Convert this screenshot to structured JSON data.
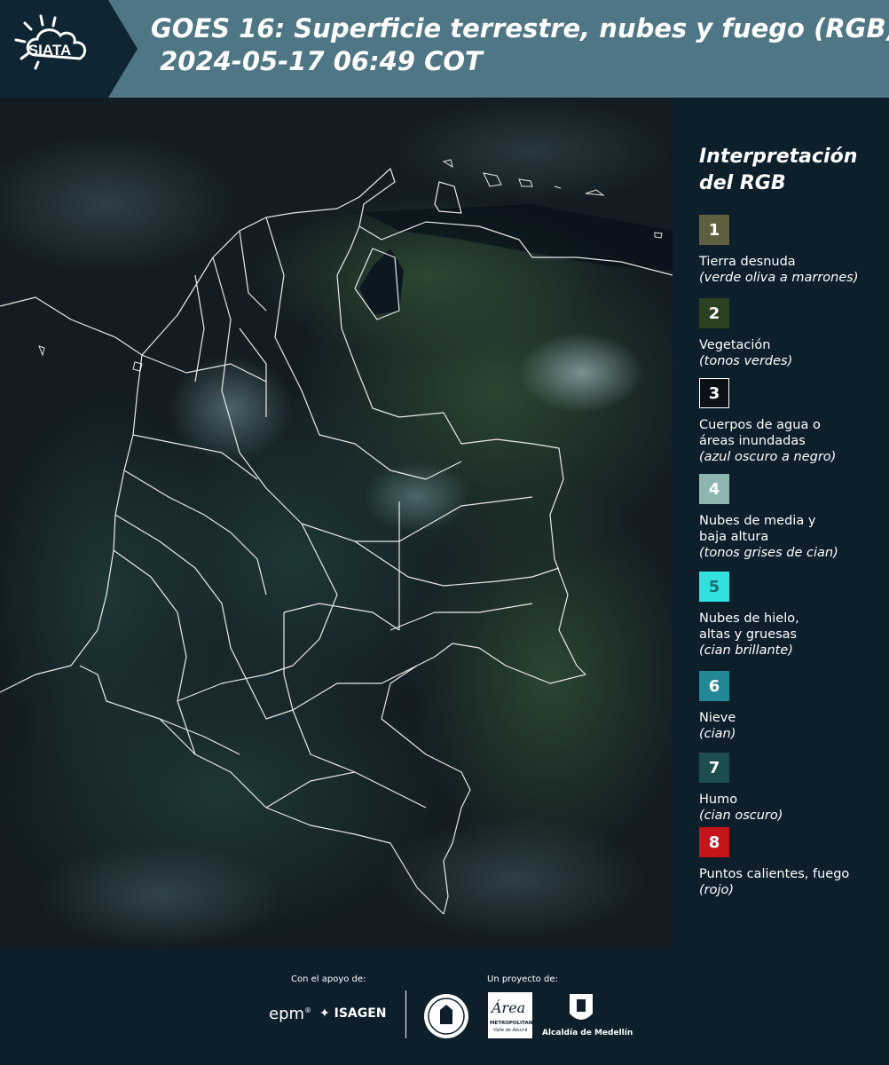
{
  "header": {
    "logo_text": "SIATA",
    "title_line1": "GOES 16: Superficie terrestre, nubes y fuego (RGB)",
    "title_line2": " 2024-05-17 06:49 COT"
  },
  "legend": {
    "title_line1": "Interpretación",
    "title_line2": "del RGB",
    "items": [
      {
        "num": "1",
        "name": "Tierra desnuda",
        "desc": "(verde oliva a marrones)",
        "color": "#5e5f3f",
        "text_color": "#ffffff"
      },
      {
        "num": "2",
        "name": "Vegetación",
        "desc": "(tonos verdes)",
        "color": "#2b4220",
        "text_color": "#ffffff"
      },
      {
        "num": "3",
        "name": "Cuerpos de agua o\náreas inundadas",
        "desc": "(azul oscuro a negro)",
        "color": "#0b1116",
        "text_color": "#ffffff"
      },
      {
        "num": "4",
        "name": "Nubes de media y\nbaja altura",
        "desc": "(tonos grises de cian)",
        "color": "#8fb6b1",
        "text_color": "#ffffff"
      },
      {
        "num": "5",
        "name": "Nubes de hielo,\naltas y gruesas",
        "desc": "(cian brillante)",
        "color": "#33e0e0",
        "text_color": "#1a6e72"
      },
      {
        "num": "6",
        "name": "Nieve",
        "desc": "(cian)",
        "color": "#238896",
        "text_color": "#ffffff"
      },
      {
        "num": "7",
        "name": "Humo",
        "desc": "(cian oscuro)",
        "color": "#1c4d4f",
        "text_color": "#ffffff"
      },
      {
        "num": "8",
        "name": "Puntos calientes, fuego",
        "desc": "(rojo)",
        "color": "#c4151b",
        "text_color": "#ffffff"
      }
    ]
  },
  "footer": {
    "support_label": "Con el apoyo de:",
    "project_label": "Un proyecto de:",
    "epm": "epm",
    "isagen": "ISAGEN",
    "area_name": "Área",
    "area_sub": "METROPOLITANA",
    "area_sub2": "Valle de Aburrá",
    "alcaldia": "Alcaldía de Medellín"
  }
}
